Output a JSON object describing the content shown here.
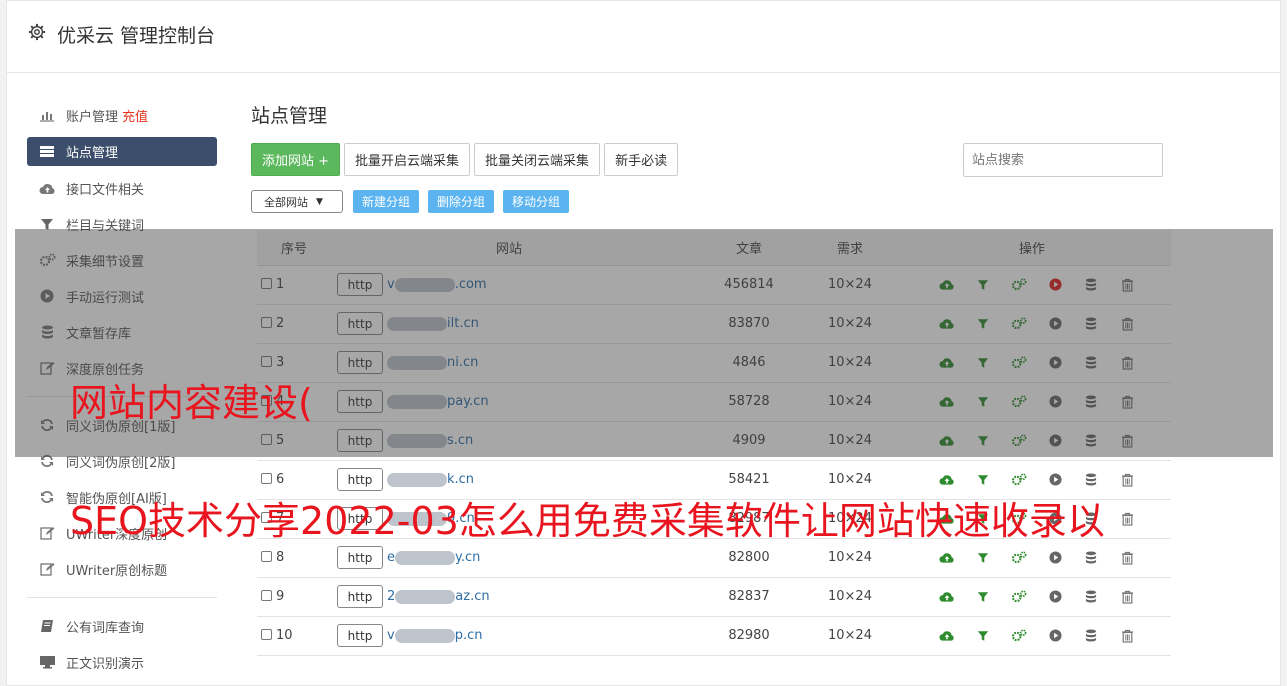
{
  "app": {
    "title": "优采云 管理控制台"
  },
  "sidebar": {
    "items": [
      {
        "label": "账户管理",
        "extra": "充值",
        "icon": "bar-chart-icon"
      },
      {
        "label": "站点管理",
        "icon": "list-icon",
        "active": true
      },
      {
        "label": "接口文件相关",
        "icon": "cloud-upload-icon"
      },
      {
        "label": "栏目与关键词",
        "icon": "filter-icon"
      },
      {
        "label": "采集细节设置",
        "icon": "gears-icon"
      },
      {
        "label": "手动运行测试",
        "icon": "play-icon"
      },
      {
        "label": "文章暂存库",
        "icon": "database-icon"
      },
      {
        "label": "深度原创任务",
        "icon": "edit-icon"
      }
    ],
    "items2": [
      {
        "label": "同义词伪原创[1版]",
        "icon": "refresh-icon"
      },
      {
        "label": "同义词伪原创[2版]",
        "icon": "refresh-icon"
      },
      {
        "label": "智能伪原创[AI版]",
        "icon": "refresh-icon"
      },
      {
        "label": "UWriter深度原创",
        "icon": "edit-icon"
      },
      {
        "label": "UWriter原创标题",
        "icon": "edit-icon"
      }
    ],
    "items3": [
      {
        "label": "公有词库查询",
        "icon": "book-icon"
      },
      {
        "label": "正文识别演示",
        "icon": "monitor-icon"
      }
    ]
  },
  "main": {
    "title": "站点管理",
    "buttons": {
      "add": "添加网站 +",
      "batch_on": "批量开启云端采集",
      "batch_off": "批量关闭云端采集",
      "guide": "新手必读"
    },
    "search_placeholder": "站点搜索",
    "group_select": "全部网站",
    "group_buttons": {
      "new": "新建分组",
      "delete": "删除分组",
      "move": "移动分组"
    },
    "table": {
      "headers": {
        "no": "序号",
        "site": "网站",
        "articles": "文章",
        "demand": "需求",
        "ops": "操作"
      },
      "rows": [
        {
          "no": "1",
          "prefix": "http",
          "visible_start": "v",
          "visible_end": ".com",
          "articles": "456814",
          "demand": "10×24",
          "play_active": true
        },
        {
          "no": "2",
          "prefix": "http",
          "visible_start": "",
          "visible_end": "ilt.cn",
          "articles": "83870",
          "demand": "10×24",
          "play_active": false
        },
        {
          "no": "3",
          "prefix": "http",
          "visible_start": "",
          "visible_end": "ni.cn",
          "articles": "4846",
          "demand": "10×24",
          "play_active": false
        },
        {
          "no": "4",
          "prefix": "http",
          "visible_start": "",
          "visible_end": "pay.cn",
          "articles": "58728",
          "demand": "10×24",
          "play_active": false
        },
        {
          "no": "5",
          "prefix": "http",
          "visible_start": "",
          "visible_end": "s.cn",
          "articles": "4909",
          "demand": "10×24",
          "play_active": false
        },
        {
          "no": "6",
          "prefix": "http",
          "visible_start": "",
          "visible_end": "k.cn",
          "articles": "58421",
          "demand": "10×24",
          "play_active": false
        },
        {
          "no": "7",
          "prefix": "http",
          "visible_start": "",
          "visible_end": "9.cn",
          "articles": "82987",
          "demand": "10×24",
          "play_active": false
        },
        {
          "no": "8",
          "prefix": "http",
          "visible_start": "e",
          "visible_end": "y.cn",
          "articles": "82800",
          "demand": "10×24",
          "play_active": false
        },
        {
          "no": "9",
          "prefix": "http",
          "visible_start": "2",
          "visible_end": "az.cn",
          "articles": "82837",
          "demand": "10×24",
          "play_active": false
        },
        {
          "no": "10",
          "prefix": "http",
          "visible_start": "v",
          "visible_end": "p.cn",
          "articles": "82980",
          "demand": "10×24",
          "play_active": false
        }
      ]
    }
  },
  "overlay": {
    "caption1": "网站内容建设(",
    "caption2": "SEO技术分享2022-03怎么用免费采集软件让网站快速收录以"
  },
  "colors": {
    "accent_green": "#5cb85c",
    "nav_active": "#3c4e6b",
    "blue_button": "#5bb4f0",
    "caption_red": "#e8141e"
  }
}
